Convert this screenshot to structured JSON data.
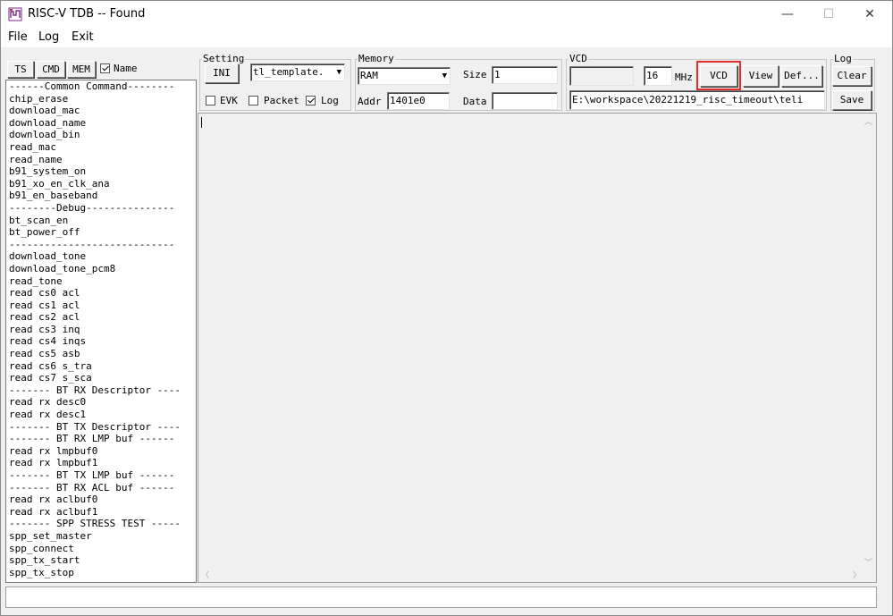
{
  "window": {
    "title": "RISC-V TDB -- Found",
    "minimize": "—",
    "maximize": "☐",
    "close": "✕"
  },
  "menu": [
    "File",
    "Log",
    "Exit"
  ],
  "tabs": {
    "ts": "TS",
    "cmd": "CMD",
    "mem": "MEM",
    "name_label": "Name",
    "name_checked": true
  },
  "commands": [
    "------Common Command--------",
    "chip_erase",
    "download_mac",
    "download_name",
    "download_bin",
    "read_mac",
    "read_name",
    "b91_system_on",
    "b91_xo_en_clk_ana",
    "b91_en_baseband",
    "--------Debug---------------",
    "bt_scan_en",
    "bt_power_off",
    "----------------------------",
    "download_tone",
    "download_tone_pcm8",
    "read_tone",
    "read cs0 acl",
    "read cs1 acl",
    "read cs2 acl",
    "read cs3 inq",
    "read cs4 inqs",
    "read cs5 asb",
    "read cs6 s_tra",
    "read cs7 s_sca",
    "------- BT RX Descriptor ----",
    "read rx desc0",
    "read rx desc1",
    "------- BT TX Descriptor ----",
    "------- BT RX LMP buf ------",
    "read rx lmpbuf0",
    "read rx lmpbuf1",
    "------- BT TX LMP buf ------",
    "------- BT RX ACL buf ------",
    "read rx aclbuf0",
    "read rx aclbuf1",
    "------- SPP STRESS TEST -----",
    "spp_set_master",
    "spp_connect",
    "spp_tx_start",
    "spp_tx_stop"
  ],
  "setting": {
    "label": "Setting",
    "ini": "INI",
    "template": "tl_template.",
    "evk": "EVK",
    "evk_checked": false,
    "packet": "Packet",
    "packet_checked": false,
    "log": "Log",
    "log_checked": true
  },
  "memory": {
    "label": "Memory",
    "type": "RAM",
    "size_label": "Size",
    "size_value": "1",
    "addr_label": "Addr",
    "addr_value": "1401e0",
    "data_label": "Data",
    "data_value": ""
  },
  "vcd": {
    "label": "VCD",
    "field1": "",
    "mhz_value": "16",
    "mhz_label": "MHz",
    "vcd_button": "VCD",
    "view_button": "View",
    "def_button": "Def...",
    "path": "E:\\workspace\\20221219_risc_timeout\\teli"
  },
  "log": {
    "label": "Log",
    "clear": "Clear",
    "save": "Save"
  },
  "colors": {
    "highlight": "#e0302a"
  }
}
